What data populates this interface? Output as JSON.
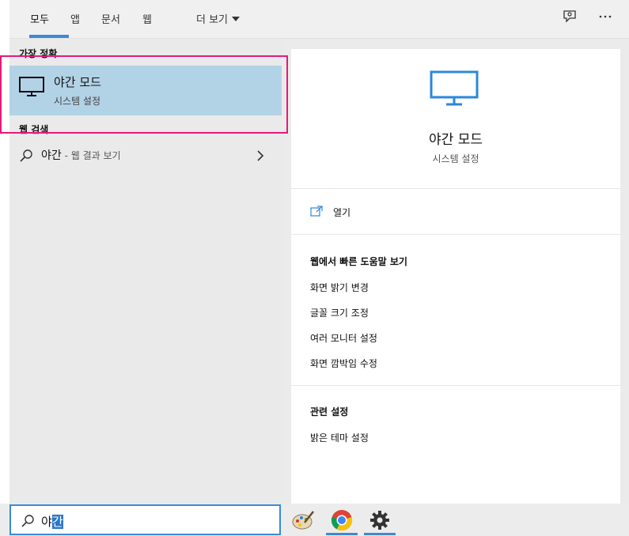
{
  "tabs": [
    {
      "label": "모두"
    },
    {
      "label": "앱"
    },
    {
      "label": "문서"
    },
    {
      "label": "웹"
    },
    {
      "label": "더 보기"
    }
  ],
  "left": {
    "best_match_header": "가장 정확",
    "best_match": {
      "title": "야간 모드",
      "subtitle": "시스템 설정"
    },
    "web_header": "웹 검색",
    "web_query": "야간",
    "web_suffix": " - 웹 결과 보기"
  },
  "right": {
    "title": "야간 모드",
    "subtitle": "시스템 설정",
    "open_label": "열기",
    "quick_help_header": "웹에서 빠른 도움말 보기",
    "quick_help_links": [
      "화면 밝기 변경",
      "글꼴 크기 조정",
      "여러 모니터 설정",
      "화면 깜박임 수정"
    ],
    "related_header": "관련 설정",
    "related_links": [
      "밝은 테마 설정"
    ]
  },
  "search": {
    "typed_prefix": "야",
    "selected_suffix": "간"
  },
  "colors": {
    "accent": "#3b8ad7",
    "highlight": "#e6197a",
    "selection": "#b2d2e6"
  }
}
